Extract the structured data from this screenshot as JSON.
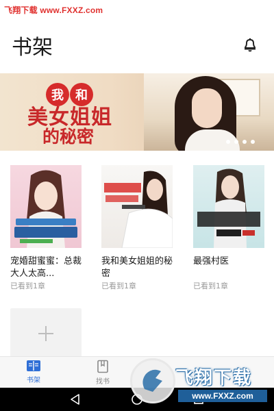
{
  "watermark_top": "飞翔下载 www.FXXZ.com",
  "header": {
    "title": "书架"
  },
  "banner": {
    "char_1": "我",
    "char_2": "和",
    "title_line1": "美女姐姐",
    "title_line2": "的秘密",
    "dot_count": 4
  },
  "books": [
    {
      "title": "宠婚甜蜜蜜：总裁大人太高...",
      "progress": "已看到1章"
    },
    {
      "title": "我和美女姐姐的秘密",
      "progress": "已看到1章"
    },
    {
      "title": "最强村医",
      "progress": "已看到1章"
    }
  ],
  "tabs": [
    {
      "label": "书架",
      "icon": "bookshelf-icon",
      "active": true
    },
    {
      "label": "找书",
      "icon": "find-book-icon",
      "active": false
    }
  ],
  "watermark_bottom": {
    "text": "飞翔下载",
    "url": "www.FXXZ.com"
  },
  "colors": {
    "accent": "#2f6fd6",
    "banner_red": "#c8282a",
    "watermark_red": "#e0312f"
  }
}
